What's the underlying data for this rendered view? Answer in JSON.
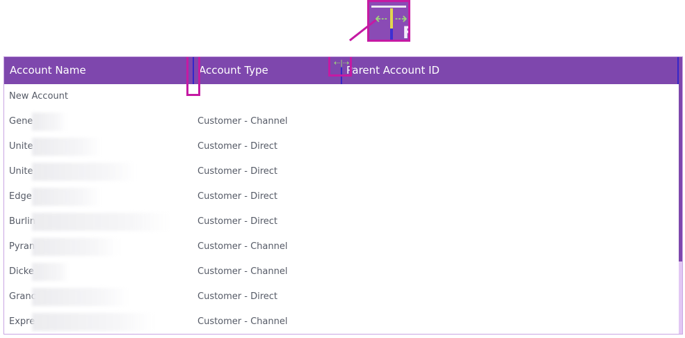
{
  "grid": {
    "columns": [
      "Account Name",
      "Account Type",
      "Parent Account ID"
    ],
    "rows": [
      {
        "name": "New Account",
        "type": ""
      },
      {
        "name": "Gene",
        "type": "Customer - Channel"
      },
      {
        "name": "Unite",
        "type": "Customer - Direct"
      },
      {
        "name": "Unite",
        "type": "Customer - Direct"
      },
      {
        "name": "Edge",
        "type": "Customer - Direct"
      },
      {
        "name": "Burlin",
        "type": "Customer - Direct"
      },
      {
        "name": "Pyran",
        "type": "Customer - Channel"
      },
      {
        "name": "Dicke",
        "type": "Customer - Channel"
      },
      {
        "name": "Granc",
        "type": "Customer - Direct"
      },
      {
        "name": "Expre",
        "type": "Customer - Channel"
      }
    ]
  },
  "callout": {
    "letter": "F"
  },
  "colors": {
    "header": "#7e47ad",
    "highlight": "#c51aa3",
    "resizer": "#3526c9",
    "scrollbar_track": "#e2c7f4"
  }
}
